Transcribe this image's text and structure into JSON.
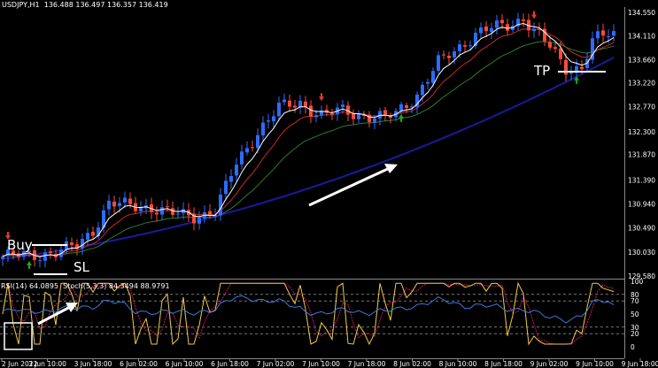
{
  "colors": {
    "background": "#000000",
    "bull_candle": "#2f6bff",
    "bear_candle": "#ff4a3a",
    "ema_fast": "#ffffff",
    "ema_mid": "#c62828",
    "ema_slow": "#2e7d32",
    "ema_long": "#1a1a9e",
    "rsi_line": "#3a7bd5",
    "stoch_main": "#f2c94c",
    "stoch_signal": "#c2185b",
    "arrow": "#ffffff"
  },
  "header": {
    "symbol": "USDJPY,H1",
    "ohlc": "136.488 136.497 136.357 136.419"
  },
  "indicator_header": {
    "rsi": "RSI(14) 64.0895",
    "stoch": "Stoch(5,3,3) 84.3494 88.9791"
  },
  "annotations": {
    "buy": "Buy",
    "sl": "SL",
    "tp": "TP"
  },
  "price_axis": [
    "134.550",
    "134.110",
    "133.660",
    "133.220",
    "132.770",
    "132.300",
    "131.870",
    "131.390",
    "130.940",
    "130.490",
    "130.030",
    "129.580"
  ],
  "indicator_axis": [
    "100",
    "80",
    "70",
    "50",
    "30",
    "20",
    "0"
  ],
  "time_axis": [
    "2 Jun 2022",
    "3 Jun 10:00",
    "3 Jun 18:00",
    "6 Jun 02:00",
    "6 Jun 10:00",
    "6 Jun 18:00",
    "7 Jun 02:00",
    "7 Jun 10:00",
    "7 Jun 18:00",
    "8 Jun 02:00",
    "8 Jun 10:00",
    "8 Jun 18:00",
    "9 Jun 02:00",
    "9 Jun 10:00",
    "9 Jun 18:00"
  ],
  "chart_data": {
    "type": "candlestick",
    "symbol": "USDJPY",
    "timeframe": "H1",
    "close_anchors": [
      [
        0,
        129.95
      ],
      [
        6,
        129.98
      ],
      [
        10,
        130.02
      ],
      [
        14,
        130.15
      ],
      [
        17,
        130.45
      ],
      [
        20,
        130.95
      ],
      [
        24,
        130.9
      ],
      [
        28,
        130.88
      ],
      [
        32,
        130.75
      ],
      [
        36,
        130.7
      ],
      [
        40,
        130.8
      ],
      [
        44,
        131.7
      ],
      [
        48,
        132.3
      ],
      [
        52,
        132.75
      ],
      [
        56,
        132.85
      ],
      [
        60,
        132.6
      ],
      [
        64,
        132.7
      ],
      [
        68,
        132.6
      ],
      [
        72,
        132.55
      ],
      [
        74,
        132.65
      ],
      [
        78,
        133.0
      ],
      [
        82,
        133.6
      ],
      [
        86,
        133.9
      ],
      [
        89,
        134.15
      ],
      [
        92,
        134.25
      ],
      [
        95,
        134.3
      ],
      [
        98,
        134.45
      ],
      [
        100,
        134.2
      ],
      [
        103,
        133.9
      ],
      [
        106,
        133.5
      ],
      [
        109,
        133.5
      ],
      [
        111,
        134.0
      ],
      [
        114,
        134.15
      ]
    ],
    "ema_fast_period": 5,
    "ema_mid_period": 10,
    "ema_slow_period": 21,
    "ema_long_period": 100,
    "ema_long_start": 129.9,
    "ema_long_end": 133.7,
    "price_min": 129.58,
    "price_max": 134.55,
    "rsi_last": 64.0895,
    "stoch_main_last": 84.3494,
    "stoch_signal_last": 88.9791,
    "indicator_levels": [
      80,
      70,
      30,
      20
    ],
    "buy_arrow_bar_indices": [
      5,
      75,
      108
    ],
    "sell_arrow_bar_indices": [
      1,
      60,
      100
    ]
  }
}
